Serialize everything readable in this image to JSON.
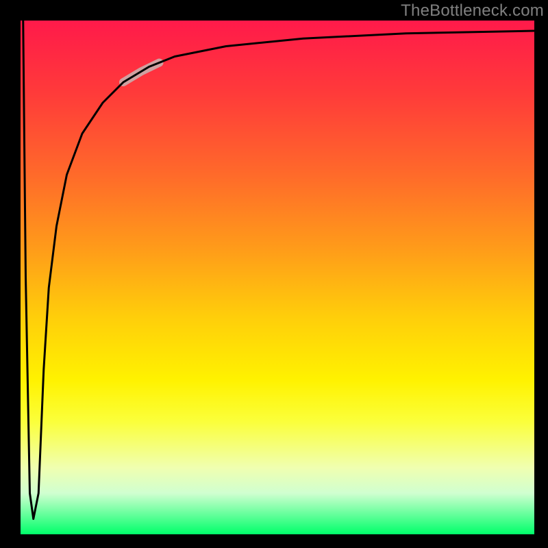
{
  "watermark": "TheBottleneck.com",
  "chart_data": {
    "type": "line",
    "title": "",
    "xlabel": "",
    "ylabel": "",
    "xlim": [
      0,
      100
    ],
    "ylim": [
      0,
      100
    ],
    "gradient_colors": {
      "top": "#ff1a4a",
      "mid_upper": "#ff9a1a",
      "mid": "#fff200",
      "mid_lower": "#f0ffb0",
      "bottom": "#00ff6a"
    },
    "series": [
      {
        "name": "curve",
        "x": [
          0.5,
          1.0,
          1.8,
          2.5,
          3.5,
          4.0,
          4.5,
          5.5,
          7.0,
          9.0,
          12.0,
          16.0,
          20.0,
          25.0,
          30.0,
          40.0,
          55.0,
          75.0,
          100.0
        ],
        "y": [
          100,
          50,
          8,
          3,
          8,
          20,
          32,
          48,
          60,
          70,
          78,
          84,
          88,
          91,
          93,
          95,
          96.5,
          97.5,
          98.0
        ]
      }
    ],
    "highlight_segment": {
      "x_start": 20,
      "x_end": 27,
      "color": "#cfa1a1",
      "width": 12
    }
  }
}
